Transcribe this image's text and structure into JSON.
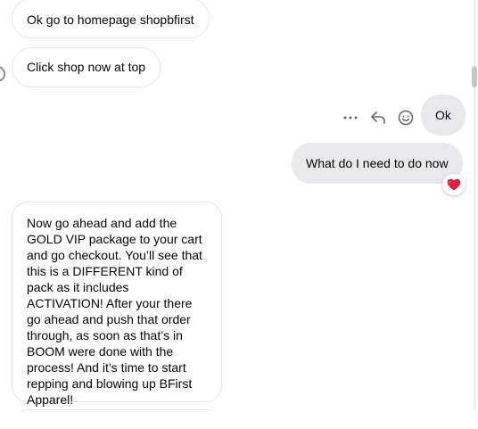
{
  "messages": [
    {
      "id": "msg1",
      "direction": "incoming",
      "text": "Ok go to homepage shopbfirst"
    },
    {
      "id": "msg2",
      "direction": "incoming",
      "text": "Click shop now at top"
    },
    {
      "id": "msg3",
      "direction": "outgoing",
      "text": "Ok"
    },
    {
      "id": "msg4",
      "direction": "outgoing",
      "text": "What do I need to do now"
    },
    {
      "id": "msg5",
      "direction": "incoming",
      "text": "Now go ahead and add the GOLD VIP package to your cart and go checkout. You’ll see that this is a DIFFERENT kind of pack as it includes ACTIVATION! After your there go ahead and push that order through, as soon as that’s in BOOM were done with the process! And it’s time to start repping and blowing up BFirst Apparel!"
    }
  ],
  "message_actions": {
    "more_icon": "more-horizontal-icon",
    "reply_icon": "reply-arrow-icon",
    "react_icon": "smiley-face-icon"
  },
  "reaction": {
    "icon": "heart-icon",
    "color": "#e41e3f"
  },
  "colors": {
    "outgoing_bubble": "#e9e9eb",
    "incoming_border": "#e4e6eb",
    "icon_gray": "#65676b"
  }
}
